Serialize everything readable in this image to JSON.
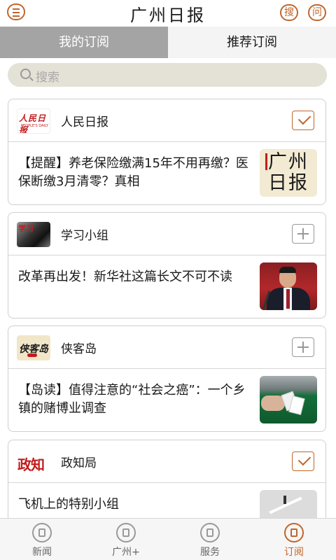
{
  "header": {
    "logo_text": "广州日报",
    "search_label": "搜",
    "ask_label": "问"
  },
  "tabs": [
    {
      "label": "我的订阅",
      "selected": false
    },
    {
      "label": "推荐订阅",
      "selected": true
    }
  ],
  "search": {
    "placeholder": "搜索"
  },
  "feeds": [
    {
      "source": "人民日报",
      "logo_text": "人民日报",
      "logo_sub": "PEOPLE'S DAILY",
      "subscribed": true,
      "headline": "【提醒】养老保险缴满15年不用再缴？医保断缴3月清零？真相",
      "thumb_text": "广州日报"
    },
    {
      "source": "学习小组",
      "logo_text": "学习",
      "logo_sub": "小组",
      "subscribed": false,
      "headline": "改革再出发！新华社这篇长文不可不读"
    },
    {
      "source": "侠客岛",
      "logo_text": "侠客岛",
      "subscribed": false,
      "headline": "【岛读】值得注意的“社会之癌”：一个乡镇的赌博业调查"
    },
    {
      "source": "政知局",
      "logo_text": "政知",
      "subscribed": true,
      "headline": "飞机上的特别小组"
    }
  ],
  "bottom_nav": [
    {
      "label": "新闻",
      "icon": "news-icon",
      "active": false
    },
    {
      "label": "广州+",
      "icon": "guangzhou-plus-icon",
      "active": false
    },
    {
      "label": "服务",
      "icon": "service-icon",
      "active": false
    },
    {
      "label": "订阅",
      "icon": "subscribe-icon",
      "active": true
    }
  ],
  "colors": {
    "accent": "#c0662d",
    "tab_selected_bg": "#a4a4a4",
    "search_bg": "#e4e1d6"
  }
}
